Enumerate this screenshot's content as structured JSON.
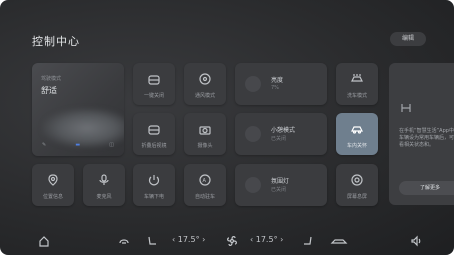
{
  "header": {
    "title": "控制中心",
    "edit_label": "编辑"
  },
  "car_mode": {
    "label": "驾驶模式",
    "value": "舒适",
    "stats": [
      "",
      "",
      ""
    ]
  },
  "tiles": {
    "unlock": "一键关闭",
    "ventilation": "通风模式",
    "mirror_fold": "折叠后视镜",
    "camera": "摄像头",
    "location": "位置信息",
    "microphone": "麦克风",
    "power_off": "车辆下电",
    "auto_park": "自动驻车",
    "wash": "洗车模式",
    "interior_care": "车内关怀",
    "screen_off": "屏幕息屏"
  },
  "wide_tiles": {
    "brightness": {
      "title": "亮度",
      "sub": "7%"
    },
    "small_sleep": {
      "title": "小憩模式",
      "sub": "已关闭"
    },
    "atmosphere": {
      "title": "氛围灯",
      "sub": "已关闭"
    }
  },
  "side_panel": {
    "text": "在手机“智慧生活”App中将车辆设为常用车辆后，可查看相关状态和。",
    "button": "了解更多"
  },
  "bottom_bar": {
    "temp_left": "17.5°",
    "temp_right": "17.5°"
  },
  "colors": {
    "accent": "#6f7f8e",
    "bg": "#2a2b2d",
    "tile": "#3b3c3f"
  }
}
